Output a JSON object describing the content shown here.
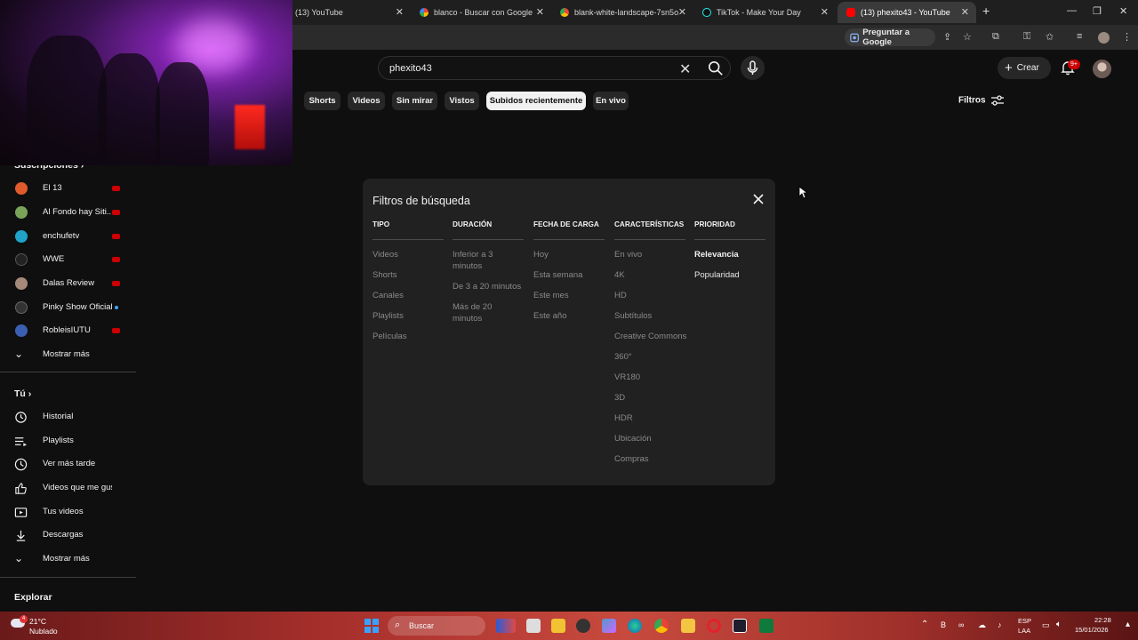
{
  "browser": {
    "tabs": [
      {
        "title": "(13) YouTube",
        "favicon_color": "#ff0000",
        "active": false
      },
      {
        "title": "blanco - Buscar con Google",
        "favicon_color": "#4285f4",
        "active": false
      },
      {
        "title": "blank-white-landscape-7sn5o1...",
        "favicon_color": "#34a853",
        "active": false
      },
      {
        "title": "TikTok - Make Your Day",
        "favicon_color": "#111111",
        "active": false
      },
      {
        "title": "(13) phexito43 - YouTube",
        "favicon_color": "#ff0000",
        "active": true
      }
    ],
    "new_tab": "+",
    "ask_google": "Preguntar a Google"
  },
  "header": {
    "search_query": "phexito43",
    "create_label": "Crear",
    "notif_badge": "9+"
  },
  "chips": [
    "Shorts",
    "Videos",
    "Sin mirar",
    "Vistos",
    "Subidos recientemente",
    "En vivo"
  ],
  "selected_chip": "Subidos recientemente",
  "filtros_label": "Filtros",
  "sidebar": {
    "subs_header": "Suscripciones",
    "subscriptions": [
      {
        "name": "El 13",
        "color": "#e05a2b",
        "live": true
      },
      {
        "name": "Al Fondo hay Siti...",
        "color": "#7aa35a",
        "live": true
      },
      {
        "name": "enchufetv",
        "color": "#1fa3c8",
        "live": true
      },
      {
        "name": "WWE",
        "color": "#222222",
        "live": true
      },
      {
        "name": "Dalas Review",
        "color": "#a58a7a",
        "live": true
      },
      {
        "name": "Pinky Show Oficial",
        "color": "#333333",
        "live": false
      },
      {
        "name": "RobleisIUTU",
        "color": "#3b5fb0",
        "live": true
      }
    ],
    "show_more": "Mostrar más",
    "you_header": "Tú",
    "you_items": [
      "Historial",
      "Playlists",
      "Ver más tarde",
      "Videos que me gus...",
      "Tus videos",
      "Descargas"
    ],
    "you_show_more": "Mostrar más",
    "explore_header": "Explorar"
  },
  "filter_dialog": {
    "title": "Filtros de búsqueda",
    "columns": [
      {
        "header": "TIPO",
        "options": [
          "Videos",
          "Shorts",
          "Canales",
          "Playlists",
          "Películas"
        ]
      },
      {
        "header": "DURACIÓN",
        "options": [
          "Inferior a 3 minutos",
          "De 3 a 20 minutos",
          "Más de 20 minutos"
        ]
      },
      {
        "header": "FECHA DE CARGA",
        "options": [
          "Hoy",
          "Esta semana",
          "Este mes",
          "Este año"
        ]
      },
      {
        "header": "CARACTERÍSTICAS",
        "options": [
          "En vivo",
          "4K",
          "HD",
          "Subtítulos",
          "Creative Commons",
          "360°",
          "VR180",
          "3D",
          "HDR",
          "Ubicación",
          "Compras"
        ]
      },
      {
        "header": "PRIORIDAD",
        "options": [
          "Relevancia",
          "Popularidad"
        ],
        "selected": "Relevancia"
      }
    ]
  },
  "taskbar": {
    "weather_temp": "21°C",
    "weather_desc": "Nublado",
    "weather_badge": "4",
    "search_label": "Buscar",
    "lang_top": "ESP",
    "lang_bottom": "LAA",
    "time": "22:28",
    "date": "15/01/2026"
  }
}
